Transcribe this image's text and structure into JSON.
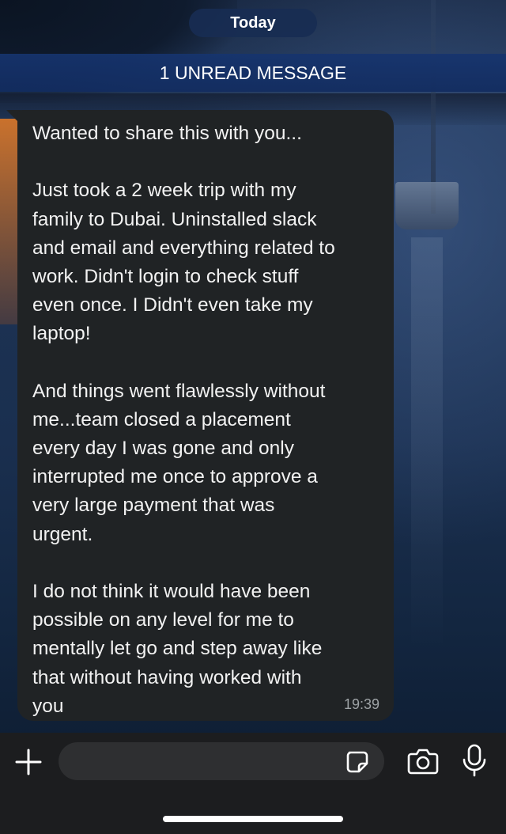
{
  "date_chip": "Today",
  "unread_banner": "1 UNREAD MESSAGE",
  "message": {
    "lines": [
      "Wanted to share this with you...",
      "",
      "Just took a 2 week trip with my",
      "family to Dubai. Uninstalled slack",
      "and email and everything related to",
      "work. Didn't login to check stuff",
      "even once. I Didn't even take my",
      "laptop!",
      "",
      "And things went flawlessly without",
      "me...team closed a placement",
      "every day I was gone and only",
      "interrupted me once to approve a",
      "very large payment that was",
      "urgent.",
      "",
      "I do not think it would have been",
      "possible on any level for me to",
      "mentally let go and step away like",
      "that without having worked with",
      "you"
    ],
    "time": "19:39"
  },
  "composer": {
    "icons": [
      "plus-icon",
      "sticker-icon",
      "camera-icon",
      "microphone-icon"
    ],
    "input_value": ""
  },
  "colors": {
    "bubble": "#202325",
    "banner": "#16346e",
    "bottom_bar": "#1c1d1f"
  }
}
